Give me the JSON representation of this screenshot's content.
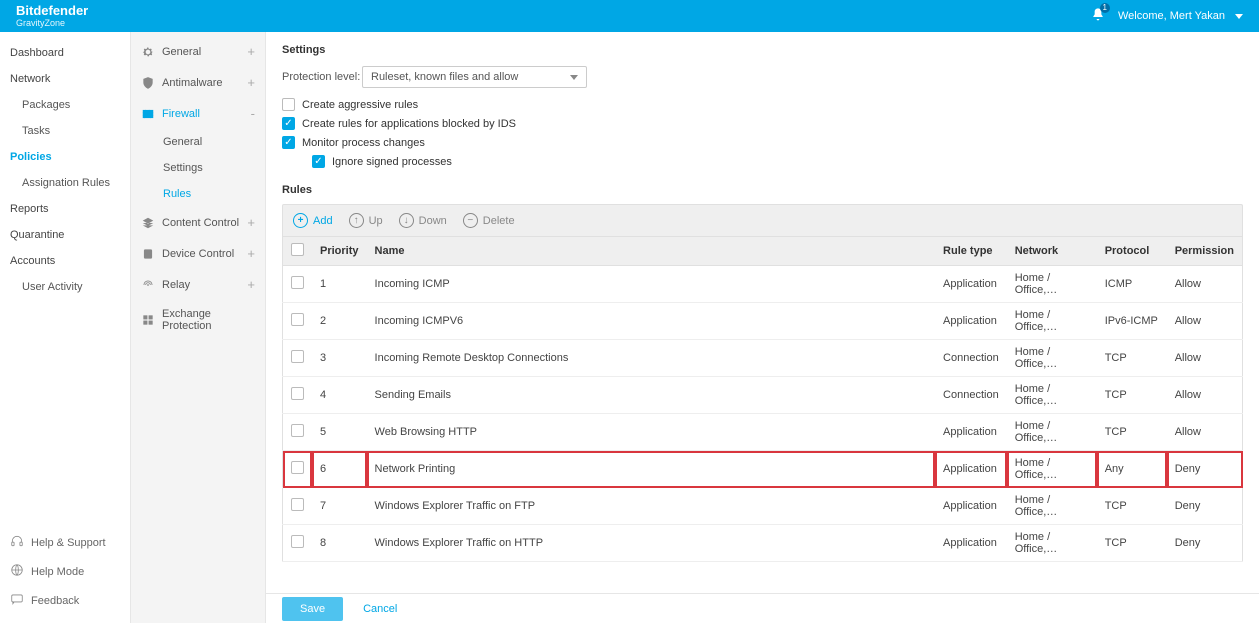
{
  "header": {
    "brand": "Bitdefender",
    "brand_sub": "GravityZone",
    "notification_count": "1",
    "welcome": "Welcome, Mert Yakan"
  },
  "leftnav": {
    "dashboard": "Dashboard",
    "network": "Network",
    "packages": "Packages",
    "tasks": "Tasks",
    "policies": "Policies",
    "assignation": "Assignation Rules",
    "reports": "Reports",
    "quarantine": "Quarantine",
    "accounts": "Accounts",
    "user_activity": "User Activity",
    "help_support": "Help & Support",
    "help_mode": "Help Mode",
    "feedback": "Feedback"
  },
  "subnav": {
    "general": "General",
    "antimalware": "Antimalware",
    "firewall": "Firewall",
    "fw_general": "General",
    "fw_settings": "Settings",
    "fw_rules": "Rules",
    "content_control": "Content Control",
    "device_control": "Device Control",
    "relay": "Relay",
    "exchange": "Exchange Protection"
  },
  "main": {
    "settings_title": "Settings",
    "protection_label": "Protection level:",
    "protection_value": "Ruleset, known files and allow",
    "cb_aggressive": "Create aggressive rules",
    "cb_ids": "Create rules for applications blocked by IDS",
    "cb_monitor": "Monitor process changes",
    "cb_signed": "Ignore signed processes",
    "rules_title": "Rules"
  },
  "toolbar": {
    "add": "Add",
    "up": "Up",
    "down": "Down",
    "delete": "Delete"
  },
  "columns": {
    "priority": "Priority",
    "name": "Name",
    "rule_type": "Rule type",
    "network": "Network",
    "protocol": "Protocol",
    "permission": "Permission"
  },
  "rules": [
    {
      "priority": "1",
      "name": "Incoming ICMP",
      "type": "Application",
      "network": "Home / Office,…",
      "protocol": "ICMP",
      "permission": "Allow",
      "hl": false
    },
    {
      "priority": "2",
      "name": "Incoming ICMPV6",
      "type": "Application",
      "network": "Home / Office,…",
      "protocol": "IPv6-ICMP",
      "permission": "Allow",
      "hl": false
    },
    {
      "priority": "3",
      "name": "Incoming Remote Desktop Connections",
      "type": "Connection",
      "network": "Home / Office,…",
      "protocol": "TCP",
      "permission": "Allow",
      "hl": false
    },
    {
      "priority": "4",
      "name": "Sending Emails",
      "type": "Connection",
      "network": "Home / Office,…",
      "protocol": "TCP",
      "permission": "Allow",
      "hl": false
    },
    {
      "priority": "5",
      "name": "Web Browsing HTTP",
      "type": "Application",
      "network": "Home / Office,…",
      "protocol": "TCP",
      "permission": "Allow",
      "hl": false
    },
    {
      "priority": "6",
      "name": "Network Printing",
      "type": "Application",
      "network": "Home / Office,…",
      "protocol": "Any",
      "permission": "Deny",
      "hl": true
    },
    {
      "priority": "7",
      "name": "Windows Explorer Traffic on FTP",
      "type": "Application",
      "network": "Home / Office,…",
      "protocol": "TCP",
      "permission": "Deny",
      "hl": false
    },
    {
      "priority": "8",
      "name": "Windows Explorer Traffic on HTTP",
      "type": "Application",
      "network": "Home / Office,…",
      "protocol": "TCP",
      "permission": "Deny",
      "hl": false
    }
  ],
  "footer": {
    "save": "Save",
    "cancel": "Cancel"
  }
}
